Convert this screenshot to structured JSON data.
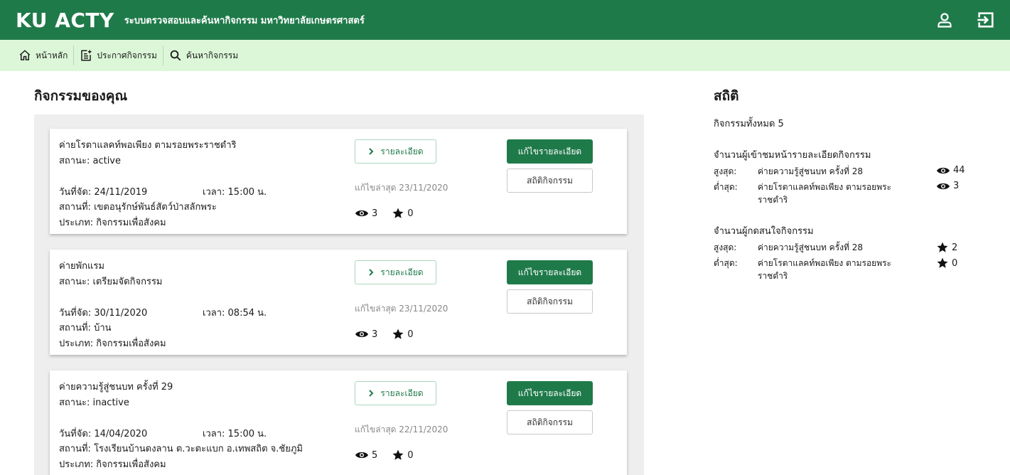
{
  "header": {
    "brand": "KU ACTY",
    "subtitle": "ระบบตรวจสอบและค้นหากิจกรรม มหาวิทยาลัยเกษตรศาสตร์"
  },
  "nav": {
    "home": "หน้าหลัก",
    "announce": "ประกาศกิจกรรม",
    "search": "ค้นหากิจกรรม"
  },
  "main": {
    "title": "กิจกรรมของคุณ",
    "cards": [
      {
        "name": "ค่ายโรตาแลคท์พอเพียง ตามรอยพระราชดำริ",
        "status": "สถานะ: active",
        "date": "วันที่จัด: 24/11/2019",
        "time": "เวลา: 15:00 น.",
        "place": "สถานที่: เขตอนุรักษ์พันธ์สัตว์ป่าสลักพระ",
        "type": "ประเภท: กิจกรรมเพื่อสังคม",
        "edited": "แก้ไขล่าสุด 23/11/2020",
        "views": "3",
        "stars": "0"
      },
      {
        "name": "ค่ายพักแรม",
        "status": "สถานะ: เตรียมจัดกิจกรรม",
        "date": "วันที่จัด: 30/11/2020",
        "time": "เวลา: 08:54 น.",
        "place": "สถานที่: บ้าน",
        "type": "ประเภท: กิจกรรมเพื่อสังคม",
        "edited": "แก้ไขล่าสุด 23/11/2020",
        "views": "3",
        "stars": "0"
      },
      {
        "name": "ค่ายความรู้สู่ชนบท ครั้งที่ 29",
        "status": "สถานะ: inactive",
        "date": "วันที่จัด: 14/04/2020",
        "time": "เวลา: 15:00 น.",
        "place": "สถานที่: โรงเรียนบ้านดงลาน ต.วะตะแบก อ.เทพสถิต จ.ชัยภูมิ",
        "type": "ประเภท: กิจกรรมเพื่อสังคม",
        "edited": "แก้ไขล่าสุด 22/11/2020",
        "views": "5",
        "stars": "0"
      }
    ],
    "detail_label": "รายละเอียด",
    "edit_label": "แก้ไขรายละเอียด",
    "stats_label": "สถิติกิจกรรม"
  },
  "stats": {
    "title": "สถิติ",
    "total": "กิจกรรมทั้งหมด 5",
    "views": {
      "heading": "จำนวนผู้เข้าชมหน้ารายละเอียดกิจกรรม",
      "max_label": "สูงสุด:",
      "max_name": "ค่ายความรู้สู่ชนบท ครั้งที่ 28",
      "max_count": "44",
      "min_label": "ต่ำสุด:",
      "min_name": "ค่ายโรตาแลคท์พอเพียง ตามรอยพระราชดำริ",
      "min_count": "3"
    },
    "interest": {
      "heading": "จำนวนผู้กดสนใจกิจกรรม",
      "max_label": "สูงสุด:",
      "max_name": "ค่ายความรู้สู่ชนบท ครั้งที่ 28",
      "max_count": "2",
      "min_label": "ต่ำสุด:",
      "min_name": "ค่ายโรตาแลคท์พอเพียง ตามรอยพระราชดำริ",
      "min_count": "0"
    }
  },
  "icons": {
    "profile": "user-icon",
    "logout": "logout-icon",
    "home": "home-icon",
    "announce": "note-add-icon",
    "search": "search-icon",
    "views": "eye-icon",
    "stars": "star-icon",
    "detail": "chevron-right-icon"
  },
  "colors": {
    "primary": "#1f7a4a",
    "nav_bg": "#dcf7d8",
    "panel_bg": "#eeeeee"
  }
}
